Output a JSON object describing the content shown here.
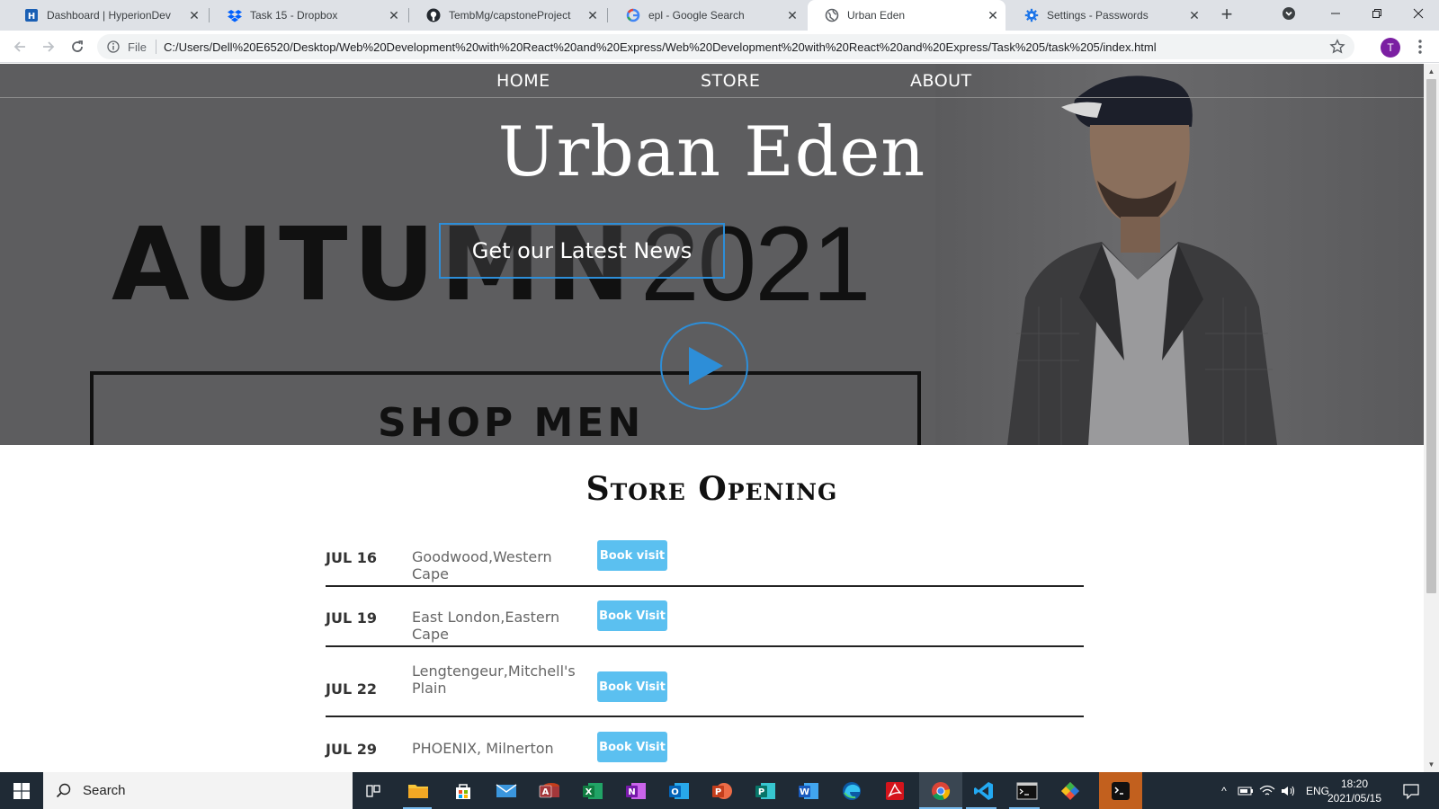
{
  "browser": {
    "tabs": [
      {
        "title": "Dashboard | HyperionDev",
        "icon": "hyperiondev-icon",
        "active": false
      },
      {
        "title": "Task 15 - Dropbox",
        "icon": "dropbox-icon",
        "active": false
      },
      {
        "title": "TembMg/capstoneProject",
        "icon": "github-icon",
        "active": false
      },
      {
        "title": "epl - Google Search",
        "icon": "google-icon",
        "active": false
      },
      {
        "title": "Urban Eden",
        "icon": "globe-icon",
        "active": true
      },
      {
        "title": "Settings - Passwords",
        "icon": "settings-gear-icon",
        "active": false
      }
    ],
    "address": {
      "scheme_label": "File",
      "url": "C:/Users/Dell%20E6520/Desktop/Web%20Development%20with%20React%20and%20Express/Web%20Development%20with%20React%20and%20Express/Task%205/task%205/index.html"
    },
    "profile_initial": "T"
  },
  "page": {
    "nav": {
      "home": "HOME",
      "store": "STORE",
      "about": "ABOUT"
    },
    "brand": "Urban Eden",
    "hero": {
      "news_button": "Get our Latest News",
      "banner_word": "AUTUMN",
      "banner_year": "2021",
      "banner_cta": "SHOP MEN"
    },
    "store_opening": {
      "title": "Store Opening",
      "rows": [
        {
          "date": "JUL 16",
          "place": "Goodwood,Western Cape",
          "button": "Book visit"
        },
        {
          "date": "JUL 19",
          "place": "East London,Eastern Cape",
          "button": "Book Visit"
        },
        {
          "date": "JUL 22",
          "place": "Lengtengeur,Mitchell's Plain",
          "button": "Book Visit"
        },
        {
          "date": "JUL 29",
          "place": "PHOENIX, Milnerton",
          "button": "Book Visit"
        }
      ]
    },
    "colors": {
      "accent_blue": "#2d8ed8",
      "book_button": "#5bc0f0",
      "hero_overlay": "#5d5d5f"
    }
  },
  "taskbar": {
    "search_placeholder": "Search",
    "language": "ENG",
    "time": "18:20",
    "date": "2021/05/15",
    "apps": [
      "task-view-icon",
      "file-explorer-icon",
      "store-icon",
      "mail-icon",
      "access-icon",
      "excel-icon",
      "onenote-icon",
      "outlook-icon",
      "powerpoint-icon",
      "publisher-icon",
      "word-icon",
      "edge-icon",
      "acrobat-icon",
      "chrome-icon",
      "vscode-icon",
      "terminal-icon",
      "git-icon",
      "bash-icon"
    ]
  }
}
